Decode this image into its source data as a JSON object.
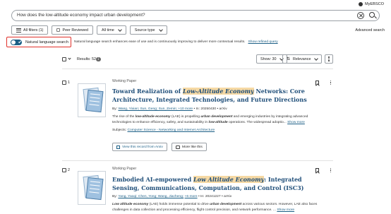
{
  "header": {
    "account_label": "MyEBSCO"
  },
  "search": {
    "query": "How does the low-altitude economy impact urban development?"
  },
  "filters": {
    "all_filters": "All filters (1)",
    "peer_reviewed": "Peer Reviewed",
    "all_time": "All time",
    "source_type": "Source type",
    "advanced": "Advanced search"
  },
  "nl": {
    "label": "Natural language search",
    "description": "Natural language search enhances ease of use and is continuously improving to deliver more contextual results.",
    "refined_link": "Show refined query"
  },
  "results_bar": {
    "count": "Results: 52",
    "show": "Show: 30",
    "sort": "Relevance"
  },
  "results": [
    {
      "number": "1",
      "type": "Working Paper",
      "title_parts": [
        "Toward Realization of ",
        "Low-Altitude Economy",
        " Networks: Core Architecture, Integrated Technologies, and Future Directions"
      ],
      "by_label": "By:",
      "authors": "Wang, Yixian; Sun, Geng; Sun, Zemin; +10 more",
      "pub": "• In: 20250430 • arXiv",
      "abstract_1": "The rise of the ",
      "abstract_h1": "low-altitude economy",
      "abstract_2": " (LAE) is propelling ",
      "abstract_h2": "urban development",
      "abstract_3": " and emerging industries by integrating advanced technologies to enhance efficiency, safety, and sustainability in ",
      "abstract_h3": "low-altitude",
      "abstract_4": " operations. The widespread adoptio...",
      "more": "Show more",
      "subjects_label": "Subjects:",
      "subjects": "Computer Science - Networking and Internet Architecture",
      "view_btn": "View this record from Arxiv",
      "mlt_btn": "More like this"
    },
    {
      "number": "2",
      "type": "Working Paper",
      "title_parts": [
        "Embodied AI-empowered ",
        "Low Altitude Economy",
        ": Integrated Sensing, Communications, Computation, and Control (ISC3)"
      ],
      "by_label": "By:",
      "authors": "Yang, Yaoqi; Chen, Yong; Wang, Jiacheng;",
      "authors_more": "+6 more",
      "pub": "• In: 20241227 • arXiv",
      "abstract_h1": "Low altitude economy",
      "abstract_2": " (LAE) holds immense potential to drive ",
      "abstract_h2": "urban development",
      "abstract_3": " across various sectors. However, LAE also faces challenges in data collection and processing efficiency, flight control precision, and network performance. ...",
      "more": "Show more"
    }
  ]
}
